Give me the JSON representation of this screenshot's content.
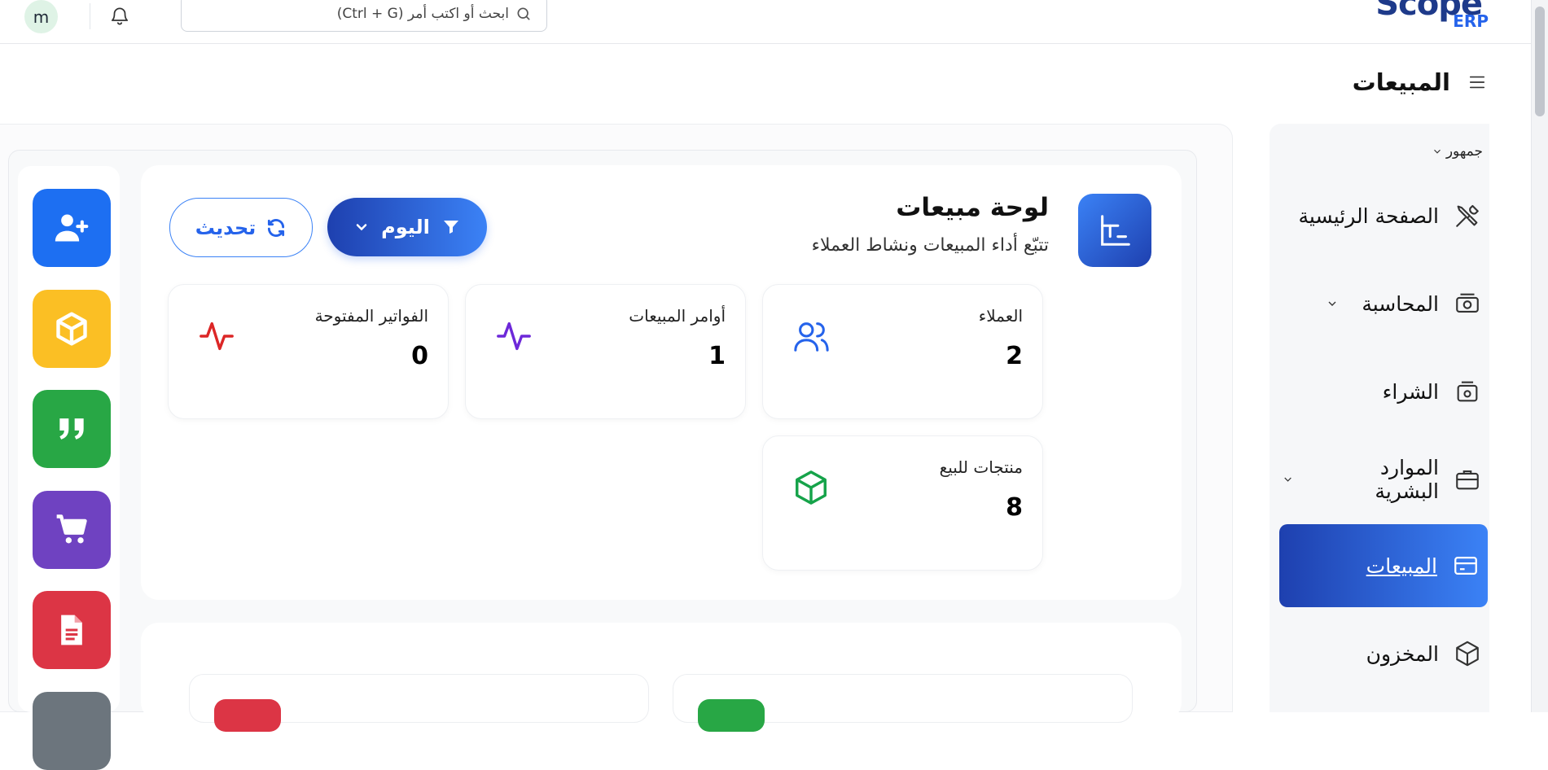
{
  "topbar": {
    "avatar_letter": "m",
    "search_placeholder": "ابحث أو اكتب أمر (Ctrl + G)",
    "logo_main": "Scope",
    "logo_sub": "ERP"
  },
  "page": {
    "title": "المبيعات"
  },
  "sidebar": {
    "branch": "جمهور",
    "items": [
      {
        "label": "الصفحة الرئيسية",
        "icon": "tools-icon"
      },
      {
        "label": "المحاسبة",
        "icon": "cash-icon",
        "expandable": true
      },
      {
        "label": "الشراء",
        "icon": "wallet-icon"
      },
      {
        "label": "الموارد البشرية",
        "icon": "briefcase-icon",
        "expandable": true
      },
      {
        "label": "المبيعات",
        "icon": "credit-card-icon",
        "active": true
      },
      {
        "label": "المخزون",
        "icon": "box-icon"
      }
    ]
  },
  "dashboard": {
    "title": "لوحة مبيعات",
    "subtitle": "تتبّع أداء المبيعات ونشاط العملاء",
    "filter_label": "اليوم",
    "refresh_label": "تحديث",
    "stats": [
      {
        "label": "العملاء",
        "value": "2",
        "icon": "users-icon",
        "color": "#2563eb"
      },
      {
        "label": "أوامر المبيعات",
        "value": "1",
        "icon": "activity-icon",
        "color": "#6d28d9"
      },
      {
        "label": "الفواتير المفتوحة",
        "value": "0",
        "icon": "activity-icon",
        "color": "#dc2626"
      },
      {
        "label": "منتجات للبيع",
        "value": "8",
        "icon": "box-icon",
        "color": "#16a34a"
      }
    ]
  },
  "quick_actions": [
    {
      "name": "add-customer-button",
      "icon": "user-plus-icon",
      "color": "#1d6ff2"
    },
    {
      "name": "add-item-button",
      "icon": "cube-icon",
      "color": "#fbbf24"
    },
    {
      "name": "add-quotation-button",
      "icon": "quote-icon",
      "color": "#28a745"
    },
    {
      "name": "add-sales-order-button",
      "icon": "cart-icon",
      "color": "#6f42c1"
    },
    {
      "name": "add-invoice-button",
      "icon": "document-icon",
      "color": "#dc3545"
    },
    {
      "name": "more-action-button",
      "icon": "more-icon",
      "color": "#6c757d"
    }
  ]
}
